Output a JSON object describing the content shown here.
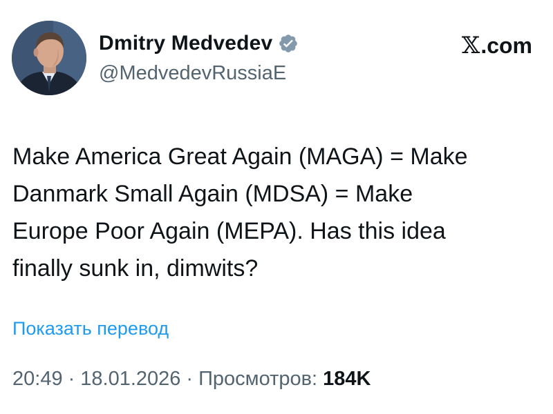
{
  "author": {
    "display_name": "Dmitry Medvedev",
    "handle": "@MedvedevRussiaE",
    "verified_icon": "verified-badge-icon",
    "badge_color": "#829aab"
  },
  "site": {
    "label": ".com",
    "logo": "x-logo-icon",
    "logo_char": "𝕏"
  },
  "tweet": {
    "text": "Make America Great Again (MAGA) = Make\nDanmark Small Again (MDSA) = Make\nEurope Poor Again (MEPA). Has this idea\nfinally sunk in, dimwits?"
  },
  "translate": {
    "label": "Показать перевод"
  },
  "meta": {
    "time": "20:49",
    "separator": "·",
    "date": "18.01.2026",
    "views_label": "Просмотров:",
    "views_count": "184K"
  },
  "colors": {
    "link": "#1d9bf0",
    "secondary_text": "#536471",
    "primary_text": "#0f1419"
  }
}
